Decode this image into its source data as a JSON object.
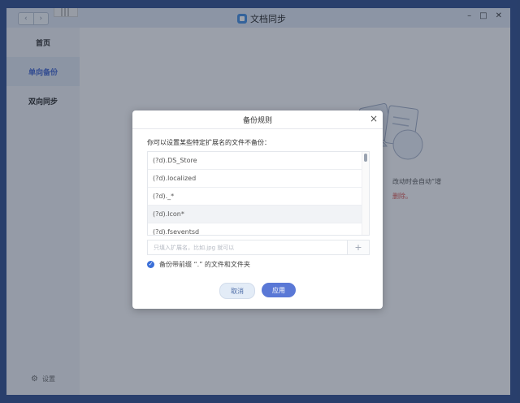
{
  "window": {
    "title": "文档同步",
    "nav_back": "‹",
    "nav_forward": "›",
    "minimize": "–",
    "maximize": "□",
    "close": "✕"
  },
  "sidebar": {
    "items": [
      {
        "label": "首页"
      },
      {
        "label": "单向备份"
      },
      {
        "label": "双向同步"
      }
    ],
    "settings_label": "设置"
  },
  "background": {
    "text_line1": "改动时会自动“增",
    "text_line2": "删除。"
  },
  "dialog": {
    "title": "备份规则",
    "close": "×",
    "description": "你可以设置某些特定扩展名的文件不备份：",
    "rules": [
      "(?d).DS_Store",
      "(?d).localized",
      "(?d)._*",
      "(?d).Icon*",
      "(?d).fseventsd"
    ],
    "input_placeholder": "只填入扩展名，比如.jpg 就可以",
    "add_label": "+",
    "checkbox_label": "备份带前缀 “.” 的文件和文件夹",
    "checkbox_checked": true,
    "cancel_label": "取消",
    "apply_label": "应用"
  },
  "colors": {
    "accent": "#3b6fd8",
    "apply_button": "#5a78d6",
    "sidebar_active": "#3a5fcd",
    "warning_text": "#d9534f"
  }
}
